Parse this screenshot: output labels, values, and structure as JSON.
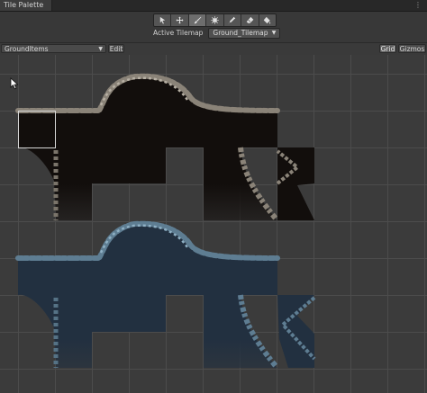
{
  "window": {
    "tab_title": "Tile Palette",
    "menu_icon": "kebab-menu-icon"
  },
  "tools": [
    {
      "name": "select",
      "icon": "select-arrow-icon",
      "active": false
    },
    {
      "name": "move",
      "icon": "move-icon",
      "active": false
    },
    {
      "name": "paint",
      "icon": "paintbrush-icon",
      "active": true
    },
    {
      "name": "box-fill",
      "icon": "box-fill-icon",
      "active": false
    },
    {
      "name": "pick",
      "icon": "eyedropper-icon",
      "active": false
    },
    {
      "name": "erase",
      "icon": "eraser-icon",
      "active": false
    },
    {
      "name": "fill",
      "icon": "bucket-fill-icon",
      "active": false
    }
  ],
  "active_tilemap": {
    "label": "Active Tilemap",
    "value": "Ground_Tilemap"
  },
  "palette": {
    "selected": "GroundItems",
    "edit_label": "Edit",
    "grid_label": "Grid",
    "gizmos_label": "Gizmos"
  },
  "colors": {
    "background": "#383838",
    "grid_line": "#4c4c4c",
    "cave_dark_fill": "#120e0c",
    "cave_dark_rock": "#8a8378",
    "cave_blue_fill": "#223040",
    "cave_blue_rock": "#5e7d92",
    "selection": "#d8d8d8"
  }
}
